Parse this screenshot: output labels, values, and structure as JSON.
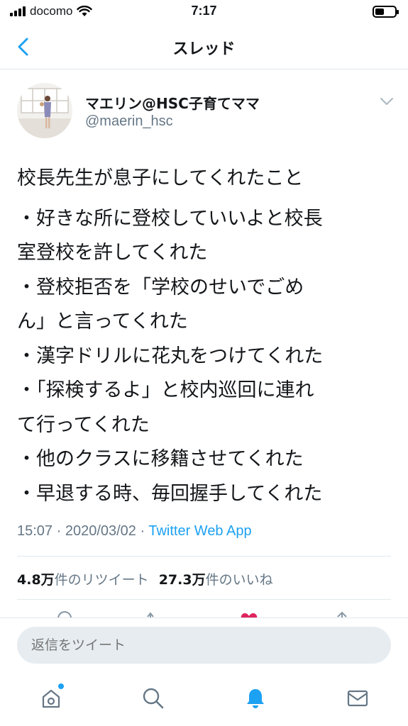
{
  "status_bar": {
    "carrier": "docomo",
    "time": "7:17"
  },
  "nav": {
    "title": "スレッド"
  },
  "tweet": {
    "display_name": "マエリン@HSC子育てママ",
    "handle": "@maerin_hsc",
    "text_lines": [
      "校長先生が息子にしてくれたこと",
      "・好きな所に登校していいよと校長",
      "室登校を許してくれた",
      "・登校拒否を「学校のせいでごめ",
      "ん」と言ってくれた",
      "・漢字ドリルに花丸をつけてくれた",
      "・「探検するよ」と校内巡回に連れ",
      "て行ってくれた",
      "・他のクラスに移籍させてくれた",
      "・早退する時、毎回握手してくれた"
    ],
    "timestamp": "15:07 · 2020/03/02 · ",
    "source_app": "Twitter Web App",
    "retweets_count": "4.8万",
    "retweets_label": "件のリツイート",
    "likes_count": "27.3万",
    "likes_label": "件のいいね"
  },
  "reply": {
    "placeholder": "返信をツイート"
  },
  "tabs": [
    "home-icon",
    "search-icon",
    "notifications-icon",
    "messages-icon"
  ],
  "colors": {
    "accent": "#1da1f2",
    "secondary_text": "#657786",
    "like": "#e0245e"
  }
}
